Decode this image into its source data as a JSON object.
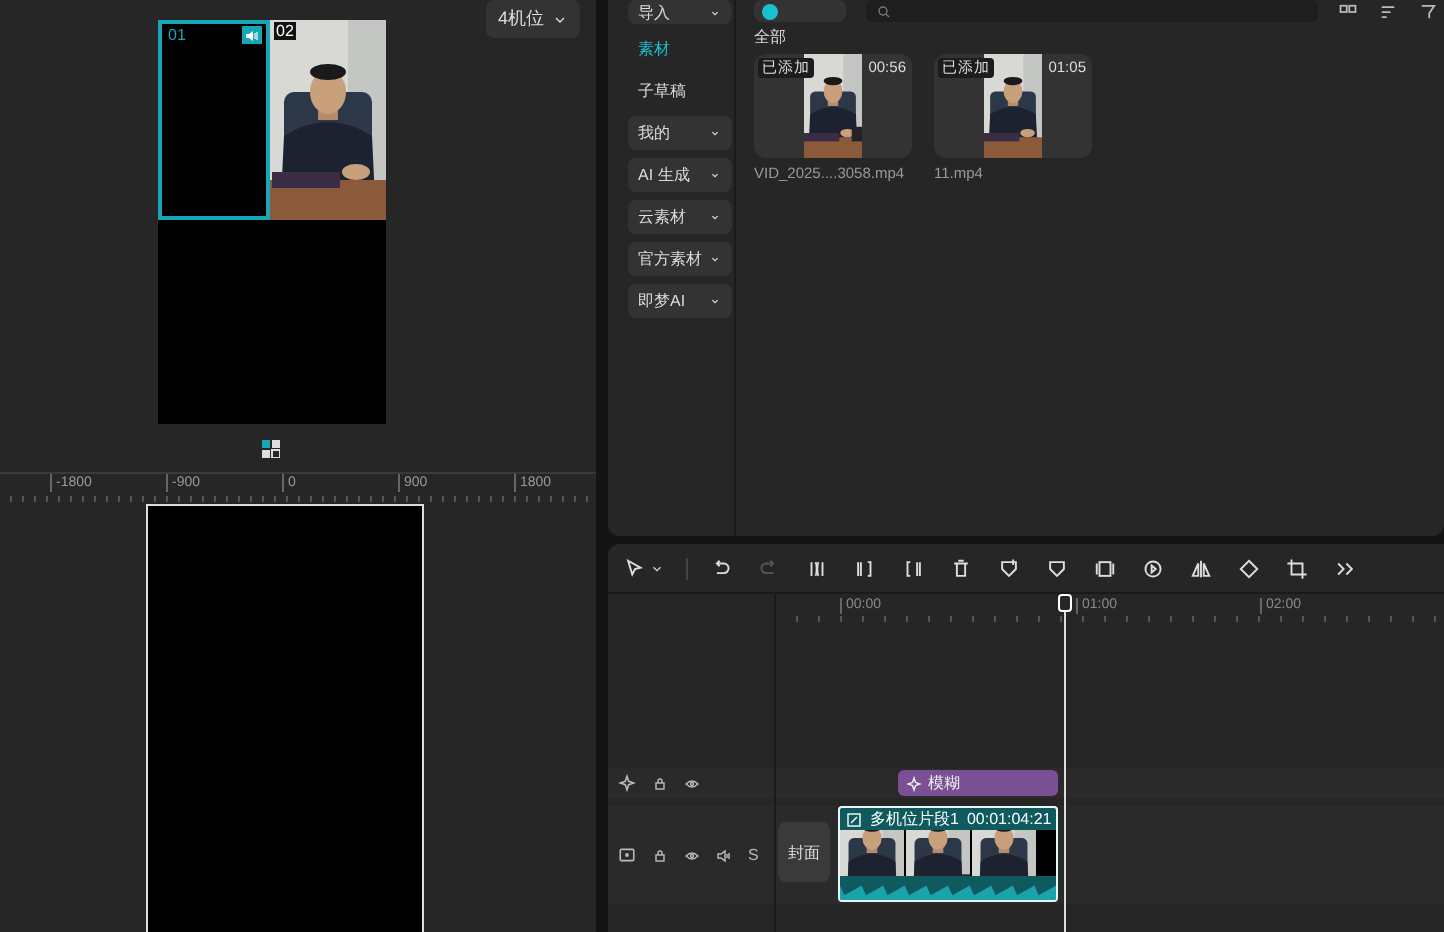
{
  "multicam": {
    "layout_dropdown": "4机位",
    "cells": [
      {
        "label": "01",
        "selected": true,
        "audio": true,
        "kind": "empty"
      },
      {
        "label": "02",
        "selected": false,
        "audio": false,
        "kind": "picture"
      }
    ]
  },
  "canvas_ruler": {
    "ticks": [
      "-1800",
      "-900",
      "0",
      "900",
      "1800"
    ]
  },
  "media": {
    "sidebar": [
      {
        "label": "导入",
        "kind": "dropdown",
        "selected": false
      },
      {
        "label": "素材",
        "kind": "link",
        "selected": true
      },
      {
        "label": "子草稿",
        "kind": "link",
        "selected": false
      },
      {
        "label": "我的",
        "kind": "dropdown",
        "selected": false
      },
      {
        "label": "AI 生成",
        "kind": "dropdown",
        "selected": false
      },
      {
        "label": "云素材",
        "kind": "dropdown",
        "selected": false
      },
      {
        "label": "官方素材",
        "kind": "dropdown",
        "selected": false
      },
      {
        "label": "即梦AI",
        "kind": "dropdown",
        "selected": false
      }
    ],
    "section_title": "全部",
    "items": [
      {
        "badge": "已添加",
        "duration": "00:56",
        "name": "VID_2025....3058.mp4"
      },
      {
        "badge": "已添加",
        "duration": "01:05",
        "name": "11.mp4"
      }
    ]
  },
  "timeline": {
    "tools": [
      {
        "kind": "select",
        "disabled": false
      },
      {
        "kind": "undo",
        "disabled": false
      },
      {
        "kind": "redo",
        "disabled": true
      },
      {
        "kind": "split",
        "disabled": false
      },
      {
        "kind": "trim_left",
        "disabled": false
      },
      {
        "kind": "trim_right",
        "disabled": false
      },
      {
        "kind": "delete",
        "disabled": false
      },
      {
        "kind": "marker",
        "disabled": false
      },
      {
        "kind": "shield",
        "disabled": false
      },
      {
        "kind": "freeze",
        "disabled": false
      },
      {
        "kind": "play",
        "disabled": false
      },
      {
        "kind": "mirror",
        "disabled": false
      },
      {
        "kind": "rotate",
        "disabled": false
      },
      {
        "kind": "crop",
        "disabled": false
      },
      {
        "kind": "more",
        "disabled": false
      }
    ],
    "ruler": [
      "00:00",
      "01:00",
      "02:00"
    ],
    "tracks": [
      {
        "kind": "effect",
        "clip": "模糊"
      },
      {
        "kind": "video",
        "solo": "S",
        "cover": "封面",
        "clip_title": "多机位片段1",
        "clip_time": "00:01:04:21"
      }
    ]
  }
}
